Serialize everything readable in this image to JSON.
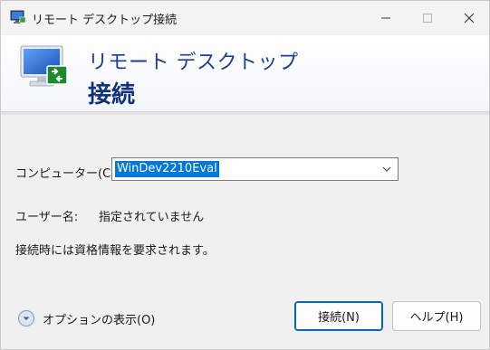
{
  "window": {
    "title": "リモート デスクトップ接続"
  },
  "banner": {
    "line1": "リモート デスクトップ",
    "line2": "接続"
  },
  "form": {
    "computer_label": "コンピューター(C):",
    "computer_value": "WinDev2210Eval",
    "user_label": "ユーザー名:",
    "user_value": "指定されていません",
    "info": "接続時には資格情報を要求されます。"
  },
  "footer": {
    "options_label": "オプションの表示(O)",
    "connect_label": "接続(N)",
    "help_label": "ヘルプ(H)"
  },
  "colors": {
    "accent": "#0078d7",
    "banner_text": "#1f3d8f",
    "selection": "#0078d7"
  },
  "icons": {
    "title": "remote-desktop-icon",
    "banner": "remote-desktop-monitor-icon",
    "options": "chevron-down-circle-icon",
    "combo": "chevron-down-icon"
  }
}
